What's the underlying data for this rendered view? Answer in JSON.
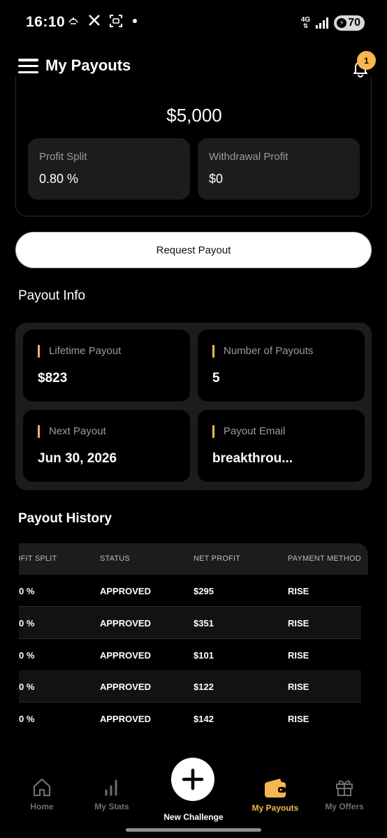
{
  "status_bar": {
    "time": "16:10",
    "network": "4G",
    "battery": "70"
  },
  "header": {
    "title": "My Payouts",
    "notification_count": "1"
  },
  "balance": {
    "amount": "$5,000",
    "profit_split_label": "Profit Split",
    "profit_split_value": "0.80 %",
    "withdrawal_label": "Withdrawal Profit",
    "withdrawal_value": "$0"
  },
  "request_button": "Request Payout",
  "payout_info": {
    "title": "Payout Info",
    "tiles": [
      {
        "label": "Lifetime Payout",
        "value": "$823"
      },
      {
        "label": "Number of Payouts",
        "value": "5"
      },
      {
        "label": "Next Payout",
        "value": "Jun 30, 2026"
      },
      {
        "label": "Payout Email",
        "value": "breakthrou..."
      }
    ]
  },
  "history": {
    "title": "Payout History",
    "columns": [
      "OFIT SPLIT",
      "STATUS",
      "NET PROFIT",
      "PAYMENT METHOD"
    ],
    "rows": [
      {
        "split": "0 %",
        "status": "APPROVED",
        "net": "$295",
        "method": "RISE"
      },
      {
        "split": "0 %",
        "status": "APPROVED",
        "net": "$351",
        "method": "RISE"
      },
      {
        "split": "0 %",
        "status": "APPROVED",
        "net": "$101",
        "method": "RISE"
      },
      {
        "split": "0 %",
        "status": "APPROVED",
        "net": "$122",
        "method": "RISE"
      },
      {
        "split": "0 %",
        "status": "APPROVED",
        "net": "$142",
        "method": "RISE"
      }
    ]
  },
  "nav": {
    "home": "Home",
    "stats": "My Stats",
    "new_challenge": "New Challenge",
    "payouts": "My Payouts",
    "offers": "My Offers"
  },
  "colors": {
    "accent": "#f5b74e",
    "background": "#000000",
    "card": "#1c1c1e"
  }
}
